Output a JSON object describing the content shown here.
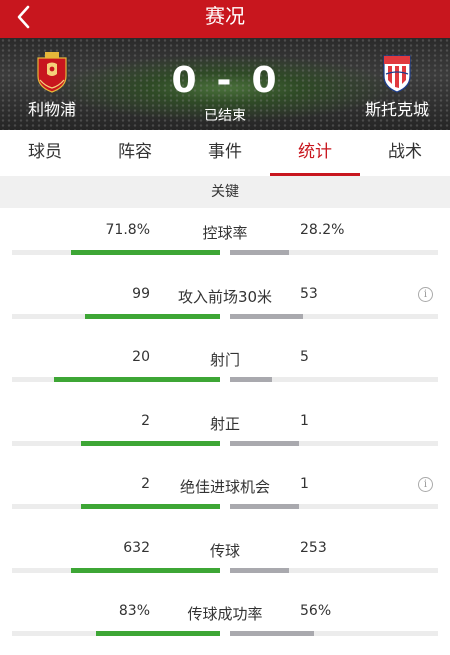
{
  "header": {
    "title": "赛况",
    "back_icon": "chevron-left-icon"
  },
  "match": {
    "home": {
      "name": "利物浦",
      "logo": "liverpool-crest-icon",
      "color": "#c8161e"
    },
    "away": {
      "name": "斯托克城",
      "logo": "stoke-crest-icon",
      "color": "#e0393e"
    },
    "home_score": "0",
    "separator": "-",
    "away_score": "0",
    "status": "已结束"
  },
  "tabs": [
    "球员",
    "阵容",
    "事件",
    "统计",
    "战术"
  ],
  "active_tab": "统计",
  "section": {
    "title": "关键"
  },
  "stats": [
    {
      "label": "控球率",
      "home": "71.8%",
      "away": "28.2%",
      "home_ratio": 0.718,
      "away_ratio": 0.282,
      "info": false
    },
    {
      "label": "攻入前场30米",
      "home": "99",
      "away": "53",
      "home_ratio": 0.651,
      "away_ratio": 0.349,
      "info": true
    },
    {
      "label": "射门",
      "home": "20",
      "away": "5",
      "home_ratio": 0.8,
      "away_ratio": 0.2,
      "info": false
    },
    {
      "label": "射正",
      "home": "2",
      "away": "1",
      "home_ratio": 0.667,
      "away_ratio": 0.333,
      "info": false
    },
    {
      "label": "绝佳进球机会",
      "home": "2",
      "away": "1",
      "home_ratio": 0.667,
      "away_ratio": 0.333,
      "info": true
    },
    {
      "label": "传球",
      "home": "632",
      "away": "253",
      "home_ratio": 0.714,
      "away_ratio": 0.286,
      "info": false
    },
    {
      "label": "传球成功率",
      "home": "83%",
      "away": "56%",
      "home_ratio": 0.597,
      "away_ratio": 0.403,
      "info": false
    }
  ],
  "colors": {
    "accent": "#c8161e",
    "home_bar": "#3da635",
    "away_bar": "#a9a9ae",
    "track": "#ececec"
  }
}
